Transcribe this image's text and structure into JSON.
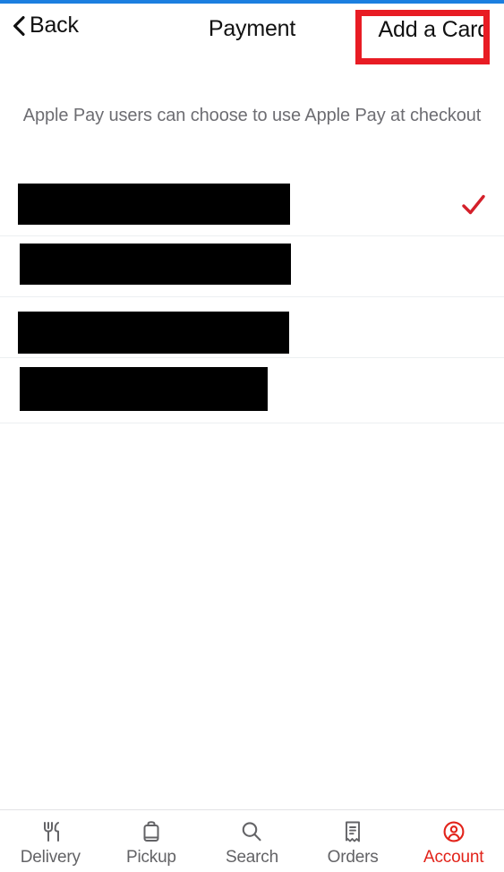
{
  "theme": {
    "accent_red": "#e2231a",
    "annotation_red": "#e81c24",
    "status_blue": "#1b7fe0",
    "text_primary": "#111111",
    "text_secondary": "#6d6d72",
    "divider": "#eceff1"
  },
  "navbar": {
    "back_label": "Back",
    "back_icon": "chevron-left-icon",
    "title": "Payment",
    "action_label": "Add a Card"
  },
  "subtitle": "Apple Pay users can choose to use Apple Pay at checkout",
  "payment_list": {
    "rows": [
      {
        "label": "",
        "redacted": true,
        "selected": true,
        "check_icon": "check-icon"
      },
      {
        "label": "",
        "redacted": true,
        "selected": false,
        "check_icon": ""
      },
      {
        "label": "",
        "redacted": true,
        "selected": false,
        "check_icon": ""
      },
      {
        "label": "",
        "redacted": true,
        "selected": false,
        "check_icon": ""
      }
    ]
  },
  "tabbar": {
    "items": [
      {
        "label": "Delivery",
        "icon": "fork-knife-icon",
        "active": false
      },
      {
        "label": "Pickup",
        "icon": "shopping-bag-icon",
        "active": false
      },
      {
        "label": "Search",
        "icon": "search-icon",
        "active": false
      },
      {
        "label": "Orders",
        "icon": "receipt-icon",
        "active": false
      },
      {
        "label": "Account",
        "icon": "account-circle-icon",
        "active": true
      }
    ]
  }
}
